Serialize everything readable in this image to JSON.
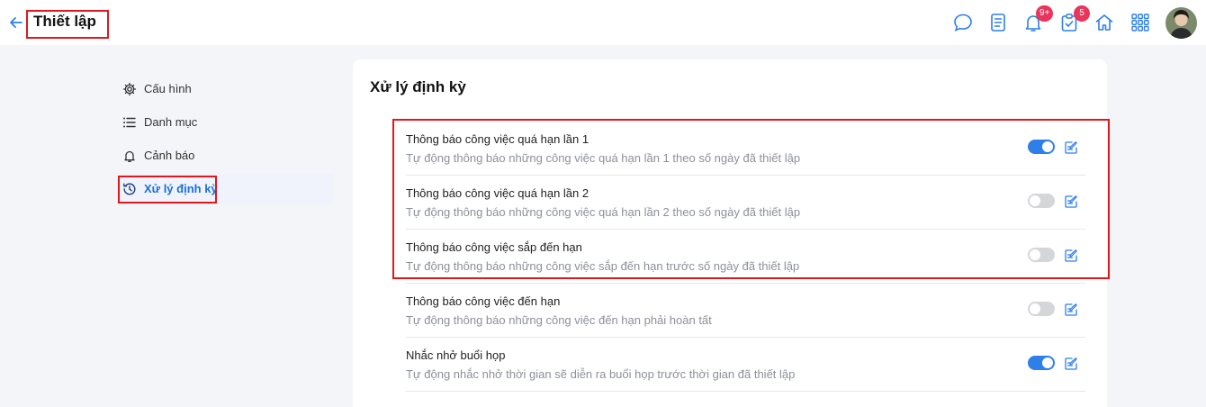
{
  "header": {
    "title": "Thiết lập",
    "notification_badge": "9+",
    "tasks_badge": "5"
  },
  "icons": {
    "back": "arrow-left-icon",
    "chat": "chat-bubble-icon",
    "document": "document-list-icon",
    "notification": "bell-icon",
    "tasks": "clipboard-check-icon",
    "home": "home-icon",
    "apps": "grid-icon"
  },
  "colors": {
    "accent": "#2f7fe8",
    "badge": "#e9355b",
    "highlight": "#e0181c"
  },
  "sidebar": {
    "items": [
      {
        "label": "Cấu hình",
        "icon": "gear-icon",
        "active": false
      },
      {
        "label": "Danh mục",
        "icon": "list-icon",
        "active": false
      },
      {
        "label": "Cảnh báo",
        "icon": "bell-icon",
        "active": false
      },
      {
        "label": "Xử lý định kỳ",
        "icon": "history-icon",
        "active": true
      }
    ]
  },
  "main": {
    "title": "Xử lý định kỳ",
    "rows": [
      {
        "title": "Thông báo công việc quá hạn lần 1",
        "description": "Tự động thông báo những công việc quá hạn lần 1 theo số ngày đã thiết lập",
        "enabled": true
      },
      {
        "title": "Thông báo công việc quá hạn lần 2",
        "description": "Tự động thông báo những công việc quá hạn lần 2 theo số ngày đã thiết lập",
        "enabled": false
      },
      {
        "title": "Thông báo công việc sắp đến hạn",
        "description": "Tự động thông báo những công việc sắp đến hạn trước số ngày đã thiết lập",
        "enabled": false
      },
      {
        "title": "Thông báo công việc đến hạn",
        "description": "Tự động thông báo những công việc đến hạn phải hoàn tất",
        "enabled": false
      },
      {
        "title": "Nhắc nhở buổi họp",
        "description": "Tự động nhắc nhở thời gian sẽ diễn ra buổi họp trước thời gian đã thiết lập",
        "enabled": true
      }
    ]
  }
}
